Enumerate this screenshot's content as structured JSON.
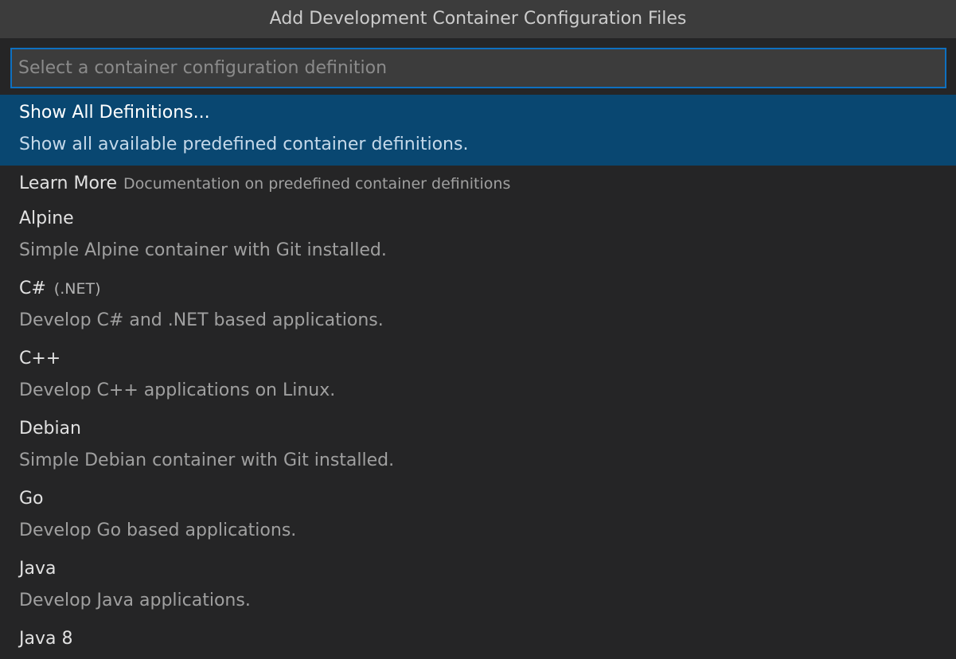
{
  "dialog": {
    "title": "Add Development Container Configuration Files",
    "search": {
      "placeholder": "Select a container configuration definition",
      "value": ""
    }
  },
  "items": [
    {
      "label": "Show All Definitions...",
      "detail": "Show all available predefined container definitions.",
      "selected": true
    },
    {
      "label": "Learn More",
      "description": "Documentation on predefined container definitions"
    },
    {
      "label": "Alpine",
      "detail": "Simple Alpine container with Git installed."
    },
    {
      "label": "C#",
      "label_extra": "(.NET)",
      "detail": "Develop C# and .NET based applications."
    },
    {
      "label": "C++",
      "detail": "Develop C++ applications on Linux."
    },
    {
      "label": "Debian",
      "detail": "Simple Debian container with Git installed."
    },
    {
      "label": "Go",
      "detail": "Develop Go based applications."
    },
    {
      "label": "Java",
      "detail": "Develop Java applications."
    },
    {
      "label": "Java 8",
      "detail": ""
    }
  ],
  "colors": {
    "background": "#252526",
    "title_bar": "#3c3c3c",
    "input_border": "#0e70c0",
    "selection": "#094771"
  }
}
